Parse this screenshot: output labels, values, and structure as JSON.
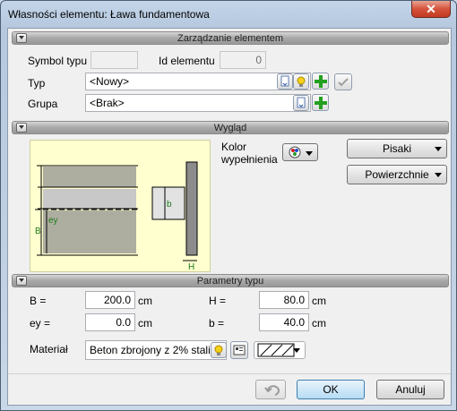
{
  "window": {
    "title": "Własności elementu: Ława fundamentowa",
    "close_label": "✕"
  },
  "management": {
    "header": "Zarządzanie elementem",
    "symbol_label": "Symbol typu",
    "symbol_value": "",
    "id_label": "Id elementu",
    "id_value": "0",
    "typ_label": "Typ",
    "typ_value": "<Nowy>",
    "grupa_label": "Grupa",
    "grupa_value": "<Brak>"
  },
  "appearance": {
    "header": "Wygląd",
    "fill_label_line1": "Kolor",
    "fill_label_line2": "wypełnienia",
    "pens_button": "Pisaki",
    "surfaces_button": "Powierzchnie",
    "drawing_labels": {
      "B": "B",
      "ey": "ey",
      "b": "b",
      "H": "H"
    }
  },
  "params": {
    "header": "Parametry typu",
    "B_label": "B =",
    "B_value": "200.0",
    "B_unit": "cm",
    "H_label": "H =",
    "H_value": "80.0",
    "H_unit": "cm",
    "ey_label": "ey =",
    "ey_value": "0.0",
    "ey_unit": "cm",
    "b_label": "b =",
    "b_value": "40.0",
    "b_unit": "cm",
    "material_label": "Materiał",
    "material_value": "Beton zbrojony z 2% stali"
  },
  "footer": {
    "ok": "OK",
    "cancel": "Anuluj"
  },
  "icons": {
    "undo": "undo-icon",
    "lightbulb": "lightbulb-icon",
    "plus": "plus-icon",
    "check": "check-icon",
    "palette": "palette-icon"
  }
}
